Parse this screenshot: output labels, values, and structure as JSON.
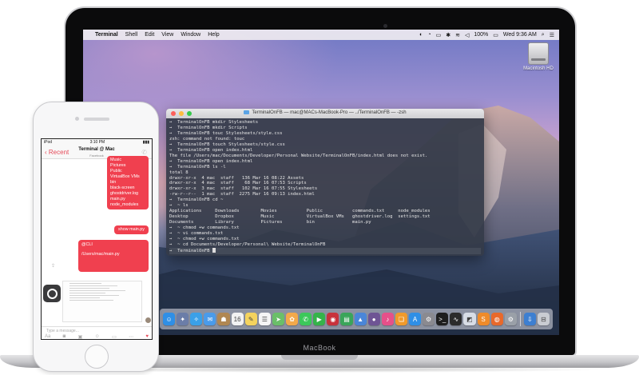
{
  "mac": {
    "brand": "MacBook",
    "menubar": {
      "app_name": "Terminal",
      "items": [
        "Shell",
        "Edit",
        "View",
        "Window",
        "Help"
      ],
      "battery": "100%",
      "clock": "Wed 9:36 AM"
    },
    "desktop_icon_label": "Macintosh HD",
    "terminal": {
      "title": "TerminalOnFB — mac@MACs-MacBook-Pro — ../TerminalOnFB — -zsh",
      "lines": [
        "→  TerminalOnFB mkdir Stylesheets",
        "→  TerminalOnFB mkdir Scripts",
        "→  TerminalOnFB touc Stylesheets/style.css",
        "zsh: command not found: touc",
        "→  TerminalOnFB touch Stylesheets/style.css",
        "→  TerminalOnFB open index.html",
        "The file /Users/mac/Documents/Developer/Personal Website/TerminalOnFB/index.html does not exist.",
        "→  TerminalOnFB open index.html",
        "→  TerminalOnFB ls -l",
        "total 8",
        "drwxr-xr-x  4 mac  staff   136 Mar 16 08:22 Assets",
        "drwxr-xr-x  4 mac  staff    68 Mar 16 07:53 Scripts",
        "drwxr-xr-x  3 mac  staff   102 Mar 16 07:55 Stylesheets",
        "-rw-r--r--  1 mac  staff  2275 Mar 16 09:13 index.html",
        "→  TerminalOnFB cd ~",
        "→  ~ ls",
        "Applications     Downloads        Movies           Public           commands.txt     node_modules",
        "Desktop          Dropbox          Music            VirtualBox VMs   ghostdriver.log  settings.txt",
        "Documents        Library          Pictures         bin              main.py",
        "→  ~ chmod +w commands.txt",
        "→  ~ vi commands.txt",
        "→  ~ chmod +w commands.txt",
        "→  ~ cd Documents/Developer/Personal\\ Website/TerminalOnFB",
        "→  TerminalOnFB "
      ]
    },
    "dock": [
      {
        "icon": "finder-icon",
        "glyph": "☺",
        "color": "#2f8fe6"
      },
      {
        "icon": "launchpad-icon",
        "glyph": "✦",
        "color": "#6b7da8"
      },
      {
        "icon": "safari-icon",
        "glyph": "✧",
        "color": "#3aa0e8"
      },
      {
        "icon": "mail-icon",
        "glyph": "✉",
        "color": "#4a9bea"
      },
      {
        "icon": "contacts-icon",
        "glyph": "☗",
        "color": "#b08752"
      },
      {
        "icon": "calendar-icon",
        "glyph": "16",
        "color": "#f2f2f2"
      },
      {
        "icon": "notes-icon",
        "glyph": "✎",
        "color": "#f4d35e"
      },
      {
        "icon": "reminders-icon",
        "glyph": "☰",
        "color": "#f5f5f5"
      },
      {
        "icon": "maps-icon",
        "glyph": "➤",
        "color": "#6abf69"
      },
      {
        "icon": "photos-icon",
        "glyph": "✿",
        "color": "#f3a94b"
      },
      {
        "icon": "messages-icon",
        "glyph": "✆",
        "color": "#3cc85a"
      },
      {
        "icon": "facetime-icon",
        "glyph": "▶",
        "color": "#35b34a"
      },
      {
        "icon": "photo-booth-icon",
        "glyph": "◉",
        "color": "#c8323c"
      },
      {
        "icon": "numbers-icon",
        "glyph": "▤",
        "color": "#3aa55a"
      },
      {
        "icon": "keynote-icon",
        "glyph": "▲",
        "color": "#4a86d8"
      },
      {
        "icon": "github-icon",
        "glyph": "●",
        "color": "#6e5494"
      },
      {
        "icon": "itunes-icon",
        "glyph": "♪",
        "color": "#e6508a"
      },
      {
        "icon": "ibooks-icon",
        "glyph": "❏",
        "color": "#f09a2b"
      },
      {
        "icon": "app-store-icon",
        "glyph": "A",
        "color": "#2f8fe6"
      },
      {
        "icon": "system-preferences-icon",
        "glyph": "⚙",
        "color": "#8a8a90"
      },
      {
        "icon": "terminal-icon",
        "glyph": ">_",
        "color": "#1e1e1e"
      },
      {
        "icon": "activity-monitor-icon",
        "glyph": "∿",
        "color": "#2b2b2b"
      },
      {
        "icon": "preview-icon",
        "glyph": "◩",
        "color": "#d8dde6"
      },
      {
        "icon": "sublime-text-icon",
        "glyph": "S",
        "color": "#ef8b2a"
      },
      {
        "icon": "firefox-icon",
        "glyph": "◍",
        "color": "#e8692b"
      },
      {
        "icon": "settings-icon",
        "glyph": "⚙",
        "color": "#9aa0a8"
      },
      {
        "icon": "downloads-stack-icon",
        "glyph": "⇩",
        "color": "#3d7fd1"
      },
      {
        "icon": "trash-icon",
        "glyph": "⊟",
        "color": "#c9ccd2"
      }
    ]
  },
  "iphone": {
    "status": {
      "carrier": "iPod",
      "time": "3:10 PM",
      "battery": "▮▮▮"
    },
    "nav": {
      "back_label": "Recent",
      "title": "Terminal @ Mac",
      "subtitle": "Facebook"
    },
    "messages": {
      "ls_output": [
        "Music",
        "Pictures",
        "Public",
        "VirtualBox VMs",
        "bin",
        "black-screen",
        "ghostdriver.log",
        "main.py",
        "node_modules"
      ],
      "button": "show main.py",
      "cli_tag": "@CLI",
      "cli_path": "/Users/mac/main.py"
    },
    "input_placeholder": "Type a message..."
  }
}
